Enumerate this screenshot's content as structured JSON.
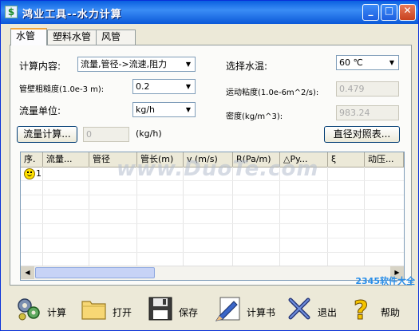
{
  "window": {
    "title": "鸿业工具--水力计算",
    "icon": "app-logo-icon",
    "controls": [
      "minimize",
      "maximize",
      "close"
    ]
  },
  "tabs": [
    {
      "label": "水管",
      "active": true
    },
    {
      "label": "塑料水管",
      "active": false
    },
    {
      "label": "风管",
      "active": false
    }
  ],
  "form": {
    "calc_content_label": "计算内容:",
    "calc_content_value": "流量,管径->流速,阻力",
    "roughness_label": "管壁粗糙度(1.0e-3 m):",
    "roughness_value": "0.2",
    "flow_unit_label": "流量单位:",
    "flow_unit_value": "kg/h",
    "flow_calc_button": "流量计算...",
    "flow_calc_value": "0",
    "flow_calc_unit": "(kg/h)",
    "water_temp_label": "选择水温:",
    "water_temp_value": "60 ℃",
    "viscosity_label": "运动粘度(1.0e-6m^2/s):",
    "viscosity_value": "0.479",
    "density_label": "密度(kg/m^3):",
    "density_value": "983.24",
    "diameter_table_button": "直径对照表..."
  },
  "grid": {
    "columns": [
      "序.",
      "流量...",
      "管径",
      "管长(m)",
      "v (m/s)",
      "R(Pa/m)",
      "△Py...",
      "ξ",
      "动压..."
    ],
    "rows": [
      {
        "seq": "1",
        "status_icon": "smiley-icon"
      }
    ]
  },
  "toolbar": [
    {
      "label": "计算",
      "icon": "gears-icon"
    },
    {
      "label": "打开",
      "icon": "folder-icon"
    },
    {
      "label": "保存",
      "icon": "floppy-disk-icon"
    },
    {
      "label": "计算书",
      "icon": "pen-document-icon"
    },
    {
      "label": "退出",
      "icon": "exit-x-icon"
    },
    {
      "label": "帮助",
      "icon": "help-question-icon"
    }
  ],
  "watermark": "www.DuoTe.com",
  "brand": "2345软件大全"
}
